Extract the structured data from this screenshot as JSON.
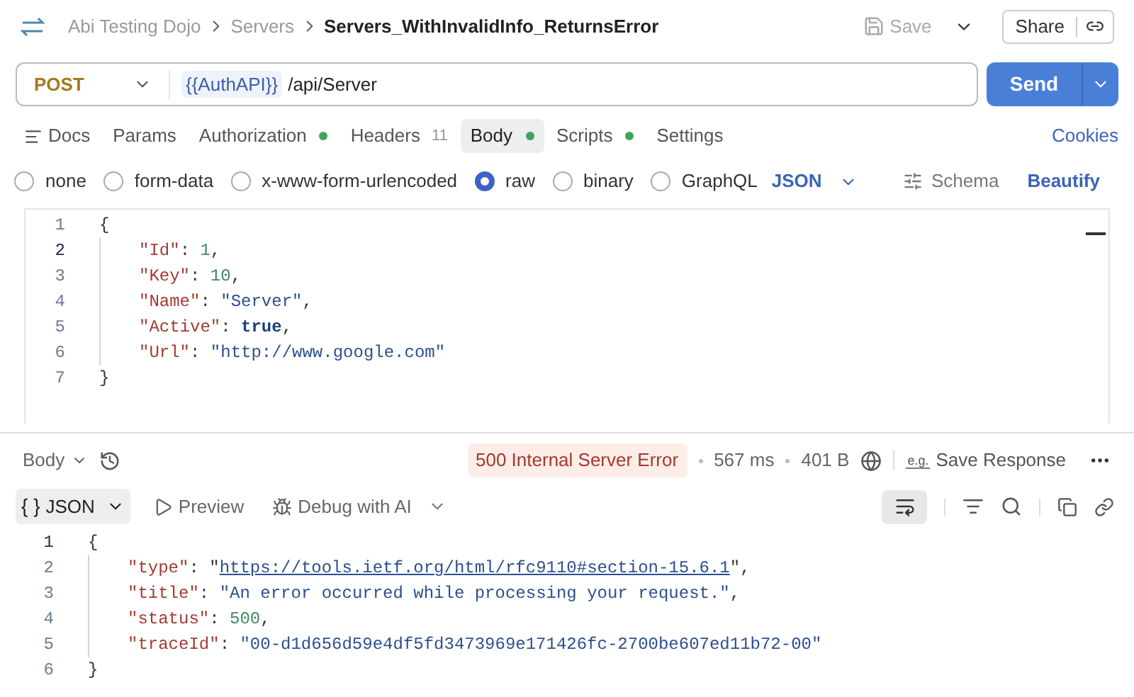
{
  "header": {
    "breadcrumbs": [
      {
        "label": "Abi Testing Dojo",
        "current": false
      },
      {
        "label": "Servers",
        "current": false
      },
      {
        "label": "Servers_WithInvalidInfo_ReturnsError",
        "current": true
      }
    ],
    "save": "Save",
    "share": "Share"
  },
  "request": {
    "method": "POST",
    "variable": "{{AuthAPI}}",
    "path": "/api/Server",
    "send": "Send"
  },
  "tabs": [
    {
      "label": "Docs",
      "selected": false,
      "icon": true
    },
    {
      "label": "Params",
      "selected": false
    },
    {
      "label": "Authorization",
      "selected": false,
      "dot": true
    },
    {
      "label": "Headers",
      "selected": false,
      "count": "11"
    },
    {
      "label": "Body",
      "selected": true,
      "dot": true
    },
    {
      "label": "Scripts",
      "selected": false,
      "dot": true
    },
    {
      "label": "Settings",
      "selected": false
    }
  ],
  "cookies": "Cookies",
  "body_types": [
    {
      "label": "none",
      "selected": false
    },
    {
      "label": "form-data",
      "selected": false
    },
    {
      "label": "x-www-form-urlencoded",
      "selected": false
    },
    {
      "label": "raw",
      "selected": true
    },
    {
      "label": "binary",
      "selected": false
    },
    {
      "label": "GraphQL",
      "selected": false
    }
  ],
  "format": "JSON",
  "schema": "Schema",
  "beautify": "Beautify",
  "request_body": [
    {
      "number": "1",
      "current": false,
      "tokens": [
        {
          "kind": "punct",
          "text": "{"
        }
      ]
    },
    {
      "number": "2",
      "current": true,
      "tokens": [
        {
          "kind": "indent"
        },
        {
          "kind": "key",
          "text": "\"Id\""
        },
        {
          "kind": "punct",
          "text": ": "
        },
        {
          "kind": "number",
          "text": "1"
        },
        {
          "kind": "punct",
          "text": ","
        }
      ]
    },
    {
      "number": "3",
      "current": false,
      "tokens": [
        {
          "kind": "indent"
        },
        {
          "kind": "key",
          "text": "\"Key\""
        },
        {
          "kind": "punct",
          "text": ": "
        },
        {
          "kind": "number",
          "text": "10"
        },
        {
          "kind": "punct",
          "text": ","
        }
      ]
    },
    {
      "number": "4",
      "current": false,
      "tokens": [
        {
          "kind": "indent"
        },
        {
          "kind": "key",
          "text": "\"Name\""
        },
        {
          "kind": "punct",
          "text": ": "
        },
        {
          "kind": "string",
          "text": "\"Server\""
        },
        {
          "kind": "punct",
          "text": ","
        }
      ]
    },
    {
      "number": "5",
      "current": false,
      "tokens": [
        {
          "kind": "indent"
        },
        {
          "kind": "key",
          "text": "\"Active\""
        },
        {
          "kind": "punct",
          "text": ": "
        },
        {
          "kind": "bool",
          "text": "true"
        },
        {
          "kind": "punct",
          "text": ","
        }
      ]
    },
    {
      "number": "6",
      "current": false,
      "tokens": [
        {
          "kind": "indent"
        },
        {
          "kind": "key",
          "text": "\"Url\""
        },
        {
          "kind": "punct",
          "text": ": "
        },
        {
          "kind": "string",
          "text": "\"http://www.google.com\""
        }
      ]
    },
    {
      "number": "7",
      "current": false,
      "tokens": [
        {
          "kind": "punct",
          "text": "}"
        }
      ]
    }
  ],
  "response": {
    "view": "Body",
    "status": "500 Internal Server Error",
    "time": "567 ms",
    "size": "401 B",
    "save": "Save Response",
    "save_mark": "e.g.",
    "tools": [
      {
        "label": "JSON",
        "kind": "format",
        "symbol": "{ }",
        "selected": true
      },
      {
        "label": "Preview",
        "kind": "preview",
        "selected": false
      },
      {
        "label": "Debug with AI",
        "kind": "debug",
        "selected": false
      }
    ],
    "wrap_on": true,
    "body": [
      {
        "number": "1",
        "current": true,
        "tokens": [
          {
            "kind": "punct",
            "text": "{"
          }
        ]
      },
      {
        "number": "2",
        "current": false,
        "tokens": [
          {
            "kind": "indent"
          },
          {
            "kind": "key",
            "text": "\"type\""
          },
          {
            "kind": "punct",
            "text": ": \""
          },
          {
            "kind": "link",
            "text": "https://tools.ietf.org/html/rfc9110#section-15.6.1"
          },
          {
            "kind": "punct",
            "text": "\","
          }
        ]
      },
      {
        "number": "3",
        "current": false,
        "tokens": [
          {
            "kind": "indent"
          },
          {
            "kind": "key",
            "text": "\"title\""
          },
          {
            "kind": "punct",
            "text": ": "
          },
          {
            "kind": "string",
            "text": "\"An error occurred while processing your request.\""
          },
          {
            "kind": "punct",
            "text": ","
          }
        ]
      },
      {
        "number": "4",
        "current": false,
        "tokens": [
          {
            "kind": "indent"
          },
          {
            "kind": "key",
            "text": "\"status\""
          },
          {
            "kind": "punct",
            "text": ": "
          },
          {
            "kind": "number",
            "text": "500"
          },
          {
            "kind": "punct",
            "text": ","
          }
        ]
      },
      {
        "number": "5",
        "current": false,
        "tokens": [
          {
            "kind": "indent"
          },
          {
            "kind": "key",
            "text": "\"traceId\""
          },
          {
            "kind": "punct",
            "text": ": "
          },
          {
            "kind": "string",
            "text": "\"00-d1d656d59e4df5fd3473969e171426fc-2700be607ed11b72-00\""
          }
        ]
      },
      {
        "number": "6",
        "current": false,
        "tokens": [
          {
            "kind": "punct",
            "text": "}"
          }
        ]
      }
    ]
  }
}
